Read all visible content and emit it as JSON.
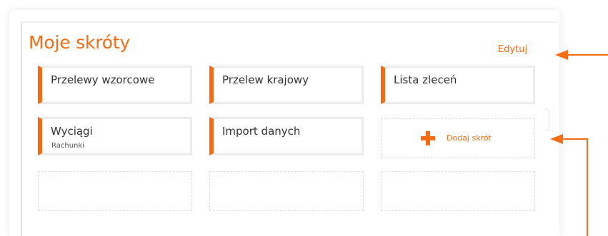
{
  "shortcuts": {
    "title": "Moje skróty",
    "edit_label": "Edytuj",
    "tiles": [
      {
        "title": "Przelewy wzorcowe",
        "subtitle": ""
      },
      {
        "title": "Przelew krajowy",
        "subtitle": ""
      },
      {
        "title": "Lista zleceń",
        "subtitle": ""
      },
      {
        "title": "Wyciągi",
        "subtitle": "Rachunki"
      },
      {
        "title": "Import danych",
        "subtitle": ""
      }
    ],
    "add_label": "Dodaj skrót",
    "add_icon": "plus-icon",
    "empty_slots": 3
  },
  "colors": {
    "accent": "#f36c16",
    "tile_border": "#ececec",
    "dashed_border": "#dedede",
    "text": "#333333"
  }
}
